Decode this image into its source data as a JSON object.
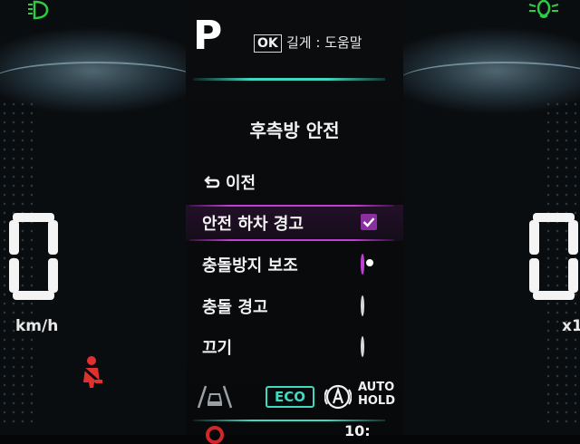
{
  "cluster": {
    "gear": "P",
    "ok_hint": {
      "badge": "OK",
      "text": "길게 : 도움말"
    },
    "colors": {
      "accent_teal": "#3fd8c0",
      "select_purple": "#c23fd6",
      "warning_red": "#e03030",
      "indicator_green": "#2ecc40"
    }
  },
  "menu": {
    "title": "후측방 안전",
    "back_label": "이전",
    "options": [
      {
        "label": "안전 하차 경고",
        "control": "checkbox",
        "checked": true,
        "selected": true
      },
      {
        "label": "충돌방지 보조",
        "control": "radio",
        "checked": true,
        "selected": false
      },
      {
        "label": "충돌 경고",
        "control": "radio",
        "checked": false,
        "selected": false
      },
      {
        "label": "끄기",
        "control": "radio",
        "checked": false,
        "selected": false
      }
    ]
  },
  "gauges": {
    "left": {
      "value": "0",
      "unit": "km/h"
    },
    "right": {
      "value": "0",
      "unit": "x1"
    }
  },
  "status": {
    "eco": "ECO",
    "auto_hold": {
      "line1": "AUTO",
      "line2": "HOLD"
    },
    "bottom_value": "10:"
  },
  "icons": [
    "headlamp-icon",
    "fog-lamp-icon",
    "seatbelt-warning-icon",
    "lane-assist-icon",
    "auto-hold-icon",
    "back-arrow-icon",
    "check-icon"
  ]
}
